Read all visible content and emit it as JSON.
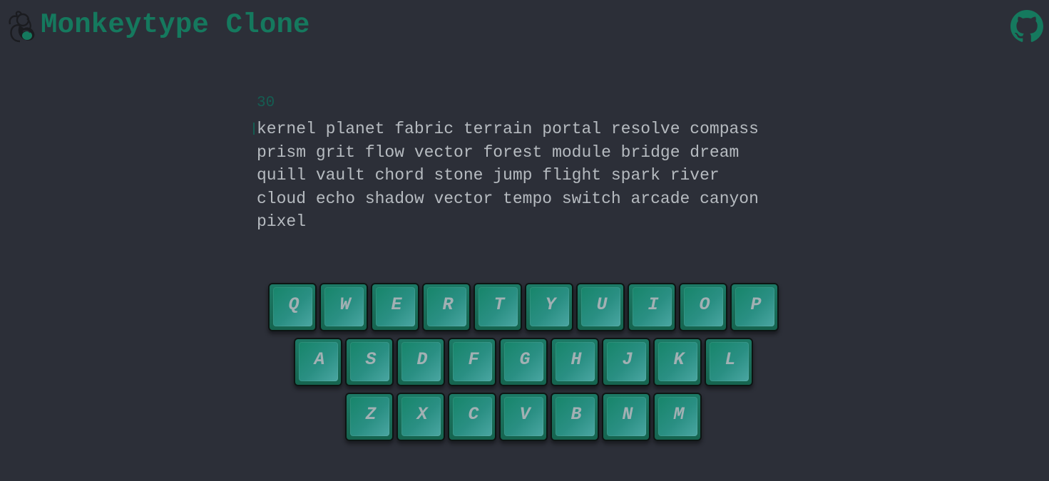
{
  "header": {
    "title": "Monkeytype Clone",
    "logo_icon": "monkey-logo-icon",
    "github_icon": "github-icon"
  },
  "test": {
    "timer": "30",
    "words": [
      "kernel planet fabric terrain portal resolve compass",
      "prism grit flow vector forest module bridge dream",
      "quill vault chord stone jump flight spark river",
      "cloud echo shadow vector tempo switch arcade canyon",
      "pixel"
    ]
  },
  "keyboard": {
    "rows": [
      [
        "Q",
        "W",
        "E",
        "R",
        "T",
        "Y",
        "U",
        "I",
        "O",
        "P"
      ],
      [
        "A",
        "S",
        "D",
        "F",
        "G",
        "H",
        "J",
        "K",
        "L"
      ],
      [
        "Z",
        "X",
        "C",
        "V",
        "B",
        "N",
        "M"
      ]
    ]
  },
  "colors": {
    "background": "#2c2f38",
    "accent": "#15795e",
    "text": "#b6bbc0",
    "timer": "#155d52"
  }
}
